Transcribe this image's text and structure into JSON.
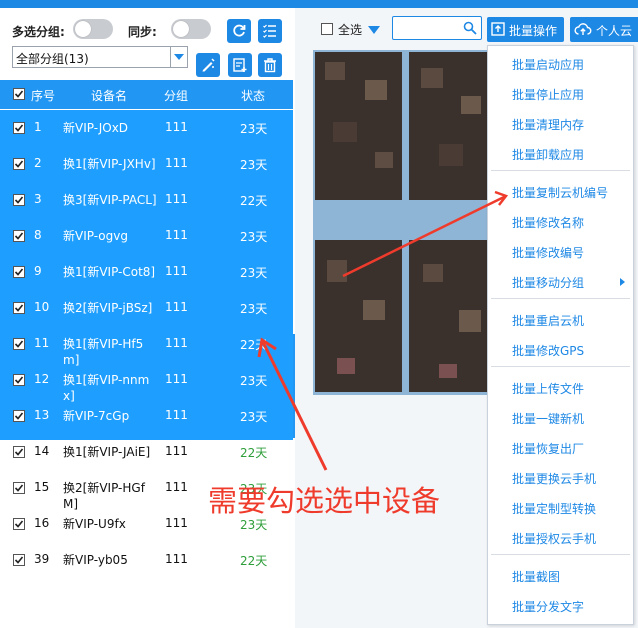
{
  "header": {
    "multi_group_label": "多选分组:",
    "sync_label": "同步:",
    "group_select_value": "全部分组(13)"
  },
  "table": {
    "columns": [
      "序号",
      "设备名",
      "分组",
      "状态"
    ],
    "rows": [
      {
        "num": "1",
        "name": "新VIP-JOxD",
        "group": "111",
        "status": "23天",
        "checked": true,
        "selected": true
      },
      {
        "num": "2",
        "name": "换1[新VIP-JXHv]",
        "group": "111",
        "status": "23天",
        "checked": true,
        "selected": true
      },
      {
        "num": "3",
        "name": "换3[新VIP-PACL]",
        "group": "111",
        "status": "22天",
        "checked": true,
        "selected": true
      },
      {
        "num": "8",
        "name": "新VIP-ogvg",
        "group": "111",
        "status": "23天",
        "checked": true,
        "selected": true
      },
      {
        "num": "9",
        "name": "换1[新VIP-Cot8]",
        "group": "111",
        "status": "23天",
        "checked": true,
        "selected": true
      },
      {
        "num": "10",
        "name": "换2[新VIP-jBSz]",
        "group": "111",
        "status": "23天",
        "checked": true,
        "selected": true
      },
      {
        "num": "11",
        "name": "换1[新VIP-Hf5m]",
        "group": "111",
        "status": "22天",
        "checked": true,
        "selected": true
      },
      {
        "num": "12",
        "name": "换1[新VIP-nnmx]",
        "group": "111",
        "status": "23天",
        "checked": true,
        "selected": true
      },
      {
        "num": "13",
        "name": "新VIP-7cGp",
        "group": "111",
        "status": "23天",
        "checked": true,
        "selected": true
      },
      {
        "num": "14",
        "name": "换1[新VIP-JAiE]",
        "group": "111",
        "status": "22天",
        "checked": true,
        "selected": false
      },
      {
        "num": "15",
        "name": "换2[新VIP-HGfM]",
        "group": "111",
        "status": "23天",
        "checked": true,
        "selected": false
      },
      {
        "num": "16",
        "name": "新VIP-U9fx",
        "group": "111",
        "status": "23天",
        "checked": true,
        "selected": false
      },
      {
        "num": "39",
        "name": "新VIP-yb05",
        "group": "111",
        "status": "22天",
        "checked": true,
        "selected": false
      }
    ]
  },
  "toolbar": {
    "select_all_label": "全选",
    "search_placeholder": "",
    "batch_button_label": "批量操作",
    "personal_button_label": "个人云"
  },
  "menu": {
    "groups": [
      [
        "批量启动应用",
        "批量停止应用",
        "批量清理内存",
        "批量卸载应用"
      ],
      [
        "批量复制云机编号",
        "批量修改名称",
        "批量修改编号",
        "批量移动分组"
      ],
      [
        "批量重启云机",
        "批量修改GPS"
      ],
      [
        "批量上传文件",
        "批量一键新机",
        "批量恢复出厂",
        "批量更换云手机",
        "批量定制型转换",
        "批量授权云手机"
      ],
      [
        "批量截图",
        "批量分发文字"
      ]
    ]
  },
  "annotation": {
    "text": "需要勾选选中设备"
  },
  "colors": {
    "accent": "#1E88E5",
    "selected_row_bg": "#1E9FFF",
    "status_green": "#2e9e3a",
    "annotation_red": "#ef3b2c"
  }
}
